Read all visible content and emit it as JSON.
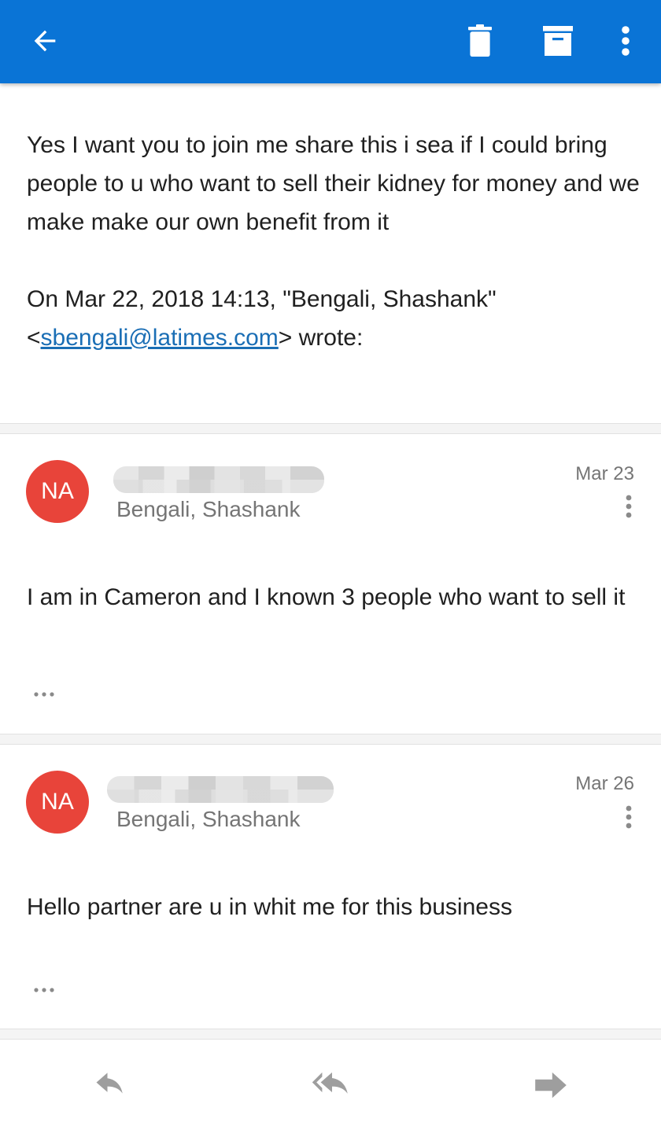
{
  "colors": {
    "accent": "#0a74d6",
    "avatar": "#e8443a",
    "link": "#1a6eb5",
    "icon_gray": "#9e9e9e"
  },
  "toolbar": {
    "back_icon": "arrow-back-icon",
    "delete_icon": "trash-icon",
    "archive_icon": "archive-icon",
    "more_icon": "more-vert-icon"
  },
  "first_message": {
    "body": "Yes I want you to join me share this i sea if I could bring people to u who want to sell their kidney for money and we make make our own benefit from it",
    "quote_prefix": "On Mar 22, 2018 14:13, \"Bengali, Shashank\" <",
    "quote_email": "sbengali@latimes.com",
    "quote_suffix": "> wrote:"
  },
  "messages": [
    {
      "avatar": "NA",
      "recipient": "Bengali, Shashank",
      "date": "Mar 23",
      "body": "I am in Cameron and I known 3 people who want to sell it"
    },
    {
      "avatar": "NA",
      "recipient": "Bengali, Shashank",
      "date": "Mar 26",
      "body": "Hello partner are u in whit me for this business"
    }
  ],
  "bottom_actions": {
    "reply_icon": "reply-icon",
    "reply_all_icon": "reply-all-icon",
    "forward_icon": "forward-icon"
  }
}
